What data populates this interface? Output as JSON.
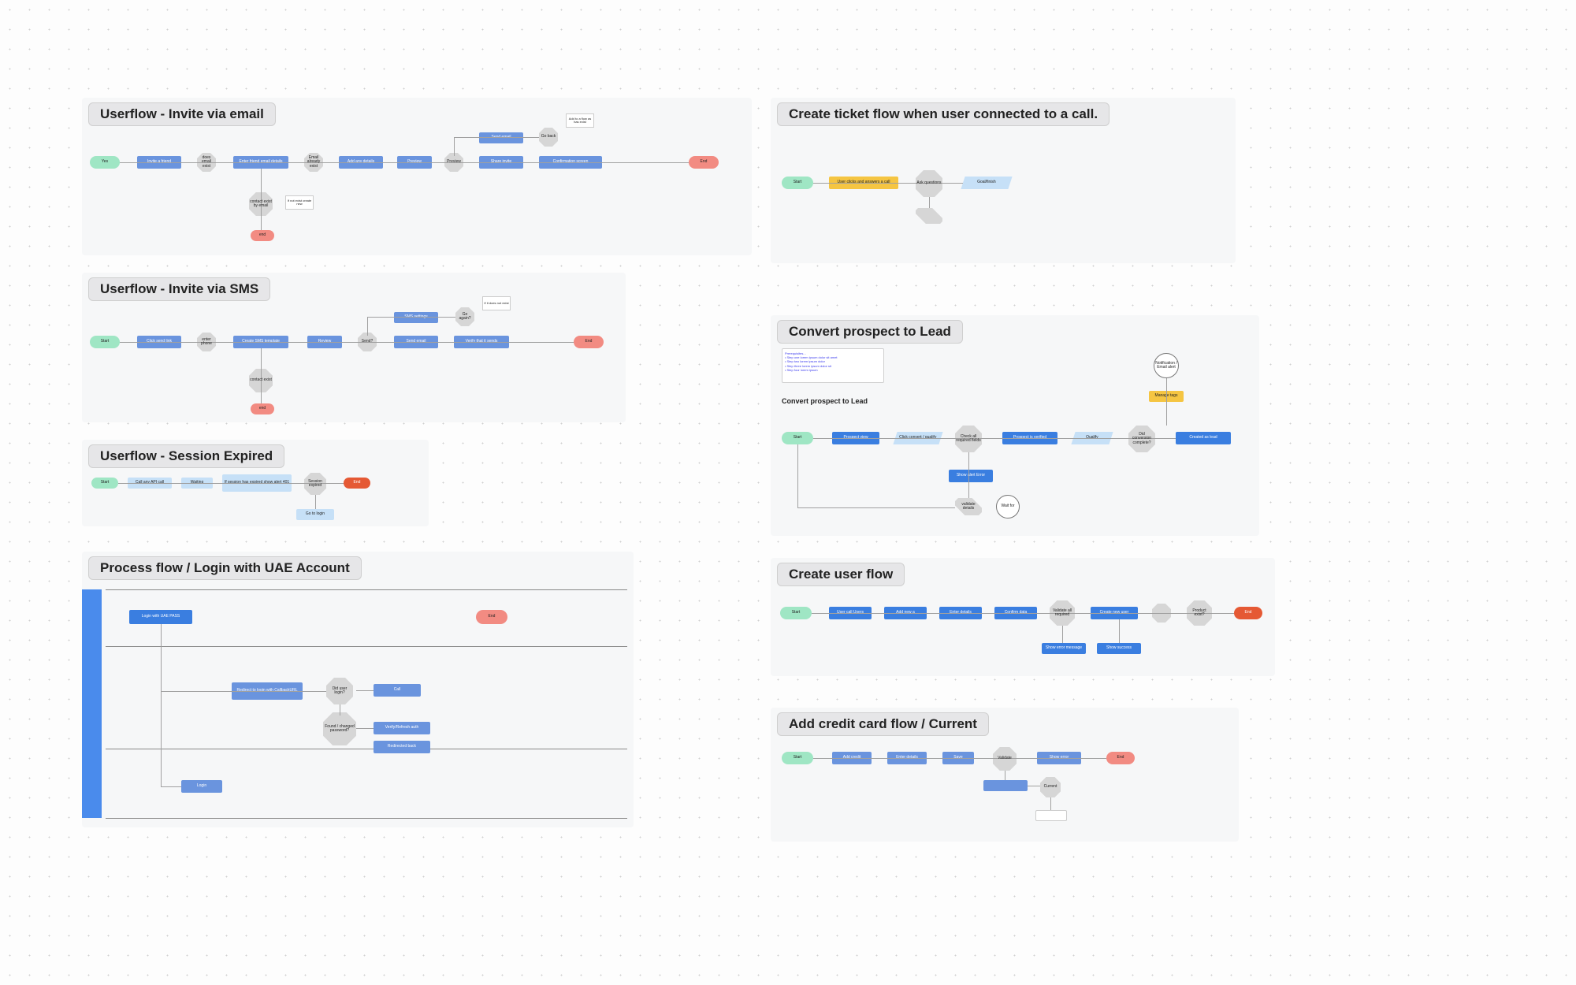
{
  "sections": {
    "invite_email": {
      "title": "Userflow - Invite via email",
      "nodes": {
        "start": "Yes",
        "n1": "Invite a friend",
        "d1": "does email exist",
        "n2": "Enter friend email details",
        "d2": "Email already exist",
        "n3": "Add any details",
        "n4": "Preview",
        "d3": "Preview",
        "n5": "Send email",
        "d4": "Go back",
        "n6": "Share invite",
        "n7": "Confirmation screen",
        "end": "End",
        "d5": "contact exist by email",
        "annotation1": "Add to a flow as has exist",
        "annotation2": "If not exist create new",
        "endalt": "end"
      }
    },
    "invite_sms": {
      "title": "Userflow - Invite via SMS",
      "nodes": {
        "start": "Start",
        "n1": "Click send link",
        "d1": "enter phone",
        "n2": "Create SMS template",
        "n3": "Review",
        "d2": "Send?",
        "n5": "SMS settings",
        "n6": "Send email",
        "d3": "Go again?",
        "n7": "Verify that it sends",
        "end": "End",
        "d5": "contact exist",
        "endalt": "end",
        "annotation1": "If it does not exist"
      }
    },
    "session_expired": {
      "title": "Userflow - Session Expired",
      "nodes": {
        "start": "Start",
        "n1": "Call any API call",
        "n2": "Waiting",
        "n3": "If session has expired show alert 401",
        "d1": "Session expired",
        "end": "End",
        "n4": "Go to login"
      }
    },
    "uae": {
      "title": "Process flow / Login with UAE Account",
      "nodes": {
        "btn": "Login with UAE PASS",
        "end": "End",
        "n1": "Redirect to login with CallbackURL",
        "d1": "Did user login?",
        "d2": "Found / changed password?",
        "n2": "Call",
        "n3": "Verify/Refresh auth",
        "n4": "Redirected back",
        "login": "Login"
      }
    },
    "ticket": {
      "title": "Create ticket flow when user connected to a call.",
      "nodes": {
        "start": "Start",
        "n1": "User clicks and answers a call",
        "d1": "Ask questions",
        "d2": "",
        "n2": "Goal/finish"
      }
    },
    "convert": {
      "title": "Convert prospect to Lead",
      "subtitle": "Convert prospect to Lead",
      "notes": "Prerequisites...\n• Step one lorem ipsum dolor sit amet\n• Step two lorem ipsum dolor\n• Step three lorem ipsum dolor sit\n• Step four lorem ipsum",
      "nodes": {
        "start": "Start",
        "n1": "Prospect view",
        "p1": "Click convert / qualify",
        "d1": "Check all required fields",
        "n2": "Prospect is verified",
        "p2": "Qualify",
        "d2": "Did conversion complete?",
        "n3": "Created as lead",
        "n4": "Show alert Error",
        "d3": "validate details",
        "c1": "Notification / Email alert",
        "c2": "Wait for",
        "y1": "Manage tags"
      }
    },
    "create_user": {
      "title": "Create user flow",
      "nodes": {
        "start": "Start",
        "n1": "User call Users",
        "n2": "Add new a",
        "n3": "Enter details",
        "n4": "Confirm data",
        "d1": "Validate all required",
        "n5": "Create new user",
        "d2": "",
        "d3": "Product exist?",
        "n6": "Show error message",
        "n7": "Show success",
        "end": "End"
      }
    },
    "credit_card": {
      "title": "Add credit card flow / Current",
      "nodes": {
        "start": "Start",
        "n1": "Add credit",
        "n2": "Enter details",
        "n3": "Save",
        "d1": "Validate",
        "n4": "Show error",
        "d2": "Current",
        "n5": "",
        "end": "End"
      }
    }
  }
}
